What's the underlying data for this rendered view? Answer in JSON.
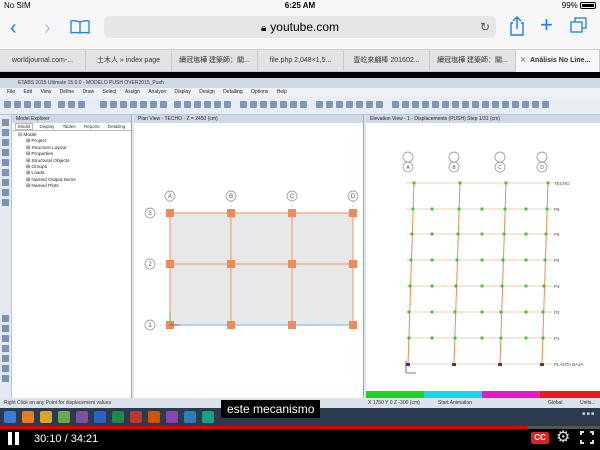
{
  "status_bar": {
    "carrier": "No SIM",
    "time": "6:25 AM",
    "battery": "99%"
  },
  "safari": {
    "url": "youtube.com",
    "icons": [
      "back-chevron-icon",
      "forward-chevron-icon",
      "bookmarks-icon",
      "lock-icon",
      "reload-icon",
      "share-icon",
      "new-tab-plus-icon",
      "tabs-overview-icon"
    ]
  },
  "browser_tabs": [
    {
      "label": "worldjournal.com-..."
    },
    {
      "label": "土木人 » index page"
    },
    {
      "label": "續冠塩樺 建築師：關..."
    },
    {
      "label": "file.php 2,048×1,5..."
    },
    {
      "label": "壹屹來翩棒 201602..."
    },
    {
      "label": "續冠塩樺 建築師：關..."
    },
    {
      "label": "Análisis No Line..."
    }
  ],
  "etabs": {
    "title": "ETABS 2015 Ultimate 15.0.0 - MODELO PUSH OVER2015_Push",
    "menu": [
      "File",
      "Edit",
      "View",
      "Define",
      "Draw",
      "Select",
      "Assign",
      "Analyze",
      "Display",
      "Design",
      "Detailing",
      "Options",
      "Help"
    ],
    "model_explorer": {
      "header": "Model Explorer",
      "tabs": [
        "Model",
        "Display",
        "Tables",
        "Reports",
        "Detailing"
      ],
      "root": "Model",
      "items": [
        "Project",
        "Structure Layout",
        "Properties",
        "Structural Objects",
        "Groups",
        "Loads",
        "Named Output Items",
        "Named Plots"
      ]
    },
    "plan_view": {
      "header": "Plan View - TECHO - Z = 2450 (cm)",
      "grid_letters": [
        "A",
        "B",
        "C",
        "D"
      ],
      "grid_numbers": [
        "3",
        "2",
        "1"
      ]
    },
    "elevation_view": {
      "header": "Elevation View - 1 - Displacements (PUSH) Step 1/31 (cm)",
      "grid_labels": [
        "A",
        "B",
        "C",
        "D"
      ],
      "story_labels": [
        "TECHO",
        "P6",
        "P5",
        "P4",
        "P3",
        "P2",
        "P1",
        "PLANTA BAJA"
      ]
    },
    "status_left": "Right Click on any Point for displacement values",
    "status_coords": "X 1750  Y 0  Z -300 (cm)",
    "status_start_animation": "Start Animation",
    "status_global": "Global",
    "status_units": "Units..."
  },
  "subtitle": "este mecanismo",
  "player": {
    "current_time": "30:10",
    "total_time": "34:21",
    "progress": 0.878,
    "cc_label": "CC",
    "accent_color": "#e00000"
  }
}
